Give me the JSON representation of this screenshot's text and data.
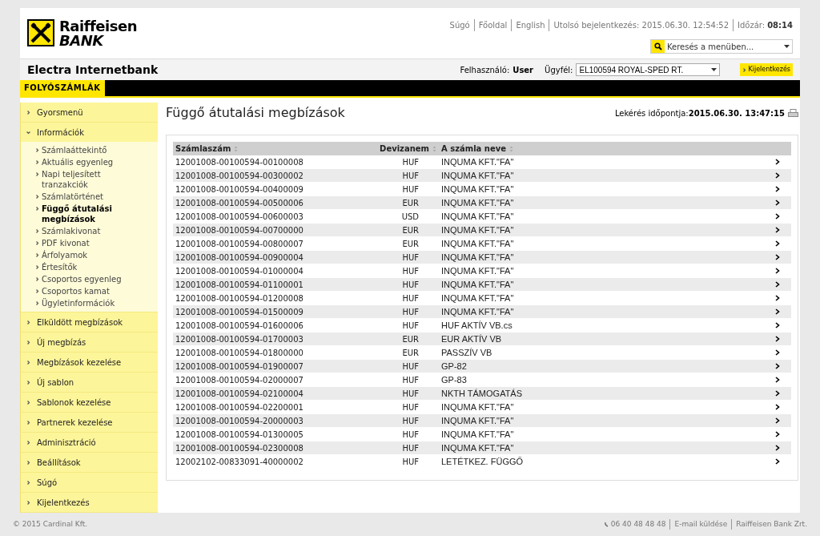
{
  "header": {
    "brand_line1": "Raiffeisen",
    "brand_line2": "BANK",
    "top_links": [
      "Súgó",
      "Főoldal",
      "English"
    ],
    "last_login_label": "Utolsó bejelentkezés:",
    "last_login": "2015.06.30. 12:54:52",
    "timeout_label": "Időzár:",
    "timeout": "08:14",
    "menu_search": {
      "value": "Keresés a menüben..."
    }
  },
  "app_bar": {
    "title": "Electra Internetbank",
    "user_label": "Felhasználó:",
    "user": "User",
    "client_label": "Ügyfél:",
    "client": "EL100594 ROYAL-SPED RT.",
    "logout": "Kijelentkezés"
  },
  "tabs": [
    {
      "label": "FOLYÓSZÁMLÁK",
      "selected": true
    }
  ],
  "sidebar": {
    "items": [
      {
        "label": "Gyorsmenü",
        "expanded": false
      },
      {
        "label": "Információk",
        "expanded": true,
        "children": [
          {
            "label": "Számlaáttekintő",
            "selected": false
          },
          {
            "label": "Aktuális egyenleg",
            "selected": false
          },
          {
            "label": "Napi teljesített tranzakciók",
            "selected": false
          },
          {
            "label": "Számlatörténet",
            "selected": false
          },
          {
            "label": "Függő átutalási megbízások",
            "selected": true
          },
          {
            "label": "Számlakivonat",
            "selected": false
          },
          {
            "label": "PDF kivonat",
            "selected": false
          },
          {
            "label": "Árfolyamok",
            "selected": false
          },
          {
            "label": "Értesítők",
            "selected": false
          },
          {
            "label": "Csoportos egyenleg",
            "selected": false
          },
          {
            "label": "Csoportos kamat",
            "selected": false
          },
          {
            "label": "Ügyletinformációk",
            "selected": false
          }
        ]
      },
      {
        "label": "Elküldött megbízások",
        "expanded": false
      },
      {
        "label": "Új megbízás",
        "expanded": false
      },
      {
        "label": "Megbízások kezelése",
        "expanded": false
      },
      {
        "label": "Új sablon",
        "expanded": false
      },
      {
        "label": "Sablonok kezelése",
        "expanded": false
      },
      {
        "label": "Partnerek kezelése",
        "expanded": false
      },
      {
        "label": "Adminisztráció",
        "expanded": false
      },
      {
        "label": "Beállítások",
        "expanded": false
      },
      {
        "label": "Súgó",
        "expanded": false
      },
      {
        "label": "Kijelentkezés",
        "expanded": false
      }
    ]
  },
  "page": {
    "title": "Függő átutalási megbízások",
    "query_time_label": "Lekérés időpontja:",
    "query_time": "2015.06.30. 13:47:15"
  },
  "table": {
    "columns": [
      "Számlaszám",
      "Devizanem",
      "A számla neve"
    ],
    "rows": [
      [
        "12001008-00100594-00100008",
        "HUF",
        "INQUMA KFT.\"FA\""
      ],
      [
        "12001008-00100594-00300002",
        "HUF",
        "INQUMA KFT.\"FA\""
      ],
      [
        "12001008-00100594-00400009",
        "HUF",
        "INQUMA KFT.\"FA\""
      ],
      [
        "12001008-00100594-00500006",
        "EUR",
        "INQUMA KFT.\"FA\""
      ],
      [
        "12001008-00100594-00600003",
        "USD",
        "INQUMA KFT.\"FA\""
      ],
      [
        "12001008-00100594-00700000",
        "EUR",
        "INQUMA KFT.\"FA\""
      ],
      [
        "12001008-00100594-00800007",
        "EUR",
        "INQUMA KFT.\"FA\""
      ],
      [
        "12001008-00100594-00900004",
        "HUF",
        "INQUMA KFT.\"FA\""
      ],
      [
        "12001008-00100594-01000004",
        "HUF",
        "INQUMA KFT.\"FA\""
      ],
      [
        "12001008-00100594-01100001",
        "HUF",
        "INQUMA KFT.\"FA\""
      ],
      [
        "12001008-00100594-01200008",
        "HUF",
        "INQUMA KFT.\"FA\""
      ],
      [
        "12001008-00100594-01500009",
        "HUF",
        "INQUMA KFT.\"FA\""
      ],
      [
        "12001008-00100594-01600006",
        "HUF",
        "HUF AKTÍV VB.cs"
      ],
      [
        "12001008-00100594-01700003",
        "EUR",
        "EUR AKTÍV VB"
      ],
      [
        "12001008-00100594-01800000",
        "EUR",
        "PASSZÍV VB"
      ],
      [
        "12001008-00100594-01900007",
        "HUF",
        "GP-82"
      ],
      [
        "12001008-00100594-02000007",
        "HUF",
        "GP-83"
      ],
      [
        "12001008-00100594-02100004",
        "HUF",
        "NKTH TÁMOGATÁS"
      ],
      [
        "12001008-00100594-02200001",
        "HUF",
        "INQUMA KFT.\"FA\""
      ],
      [
        "12001008-00100594-20000003",
        "HUF",
        "INQUMA KFT.\"FA\""
      ],
      [
        "12001008-00100594-01300005",
        "HUF",
        "INQUMA KFT.\"FA\""
      ],
      [
        "12001008-00100594-02300008",
        "HUF",
        "INQUMA KFT.\"FA\""
      ],
      [
        "12002102-00833091-40000002",
        "HUF",
        "LETÉTKEZ. FÜGGŐ"
      ]
    ]
  },
  "footer": {
    "copyright": "© 2015 Cardinal Kft.",
    "phone": "06 40 48 48 48",
    "links": [
      "E-mail küldése",
      "Raiffeisen Bank Zrt."
    ]
  }
}
